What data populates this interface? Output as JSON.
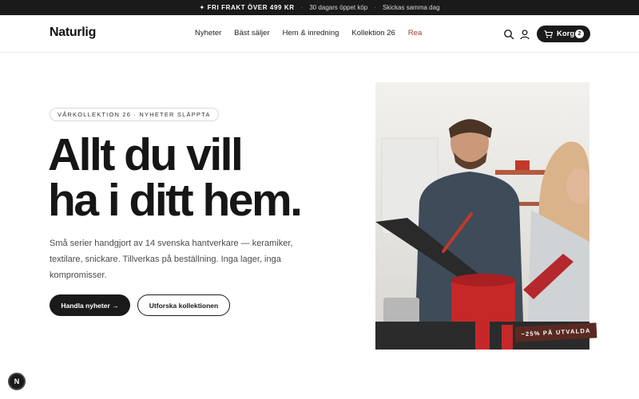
{
  "announcement": {
    "lead": "✦ FRI FRAKT ÖVER 499 KR",
    "item2": "30 dagars öppet köp",
    "item3": "Skickas samma dag",
    "separator": "·"
  },
  "header": {
    "logo": "Naturlig",
    "nav": [
      "Nyheter",
      "Bäst säljer",
      "Hem & inredning",
      "Kollektion 26",
      "Rea"
    ],
    "cart_label": "Korg",
    "cart_count": "2"
  },
  "hero": {
    "pill": "VÅRKOLLEKTION 26 · NYHETER SLÄPPTA",
    "headline_line1": "Allt du vill",
    "headline_line2": "ha i ditt hem.",
    "lede": "Små serier handgjort av 14 svenska hantverkare — keramiker, textilare, snickare. Tillverkas på beställning. Inga lager, inga kompromisser.",
    "cta_primary": "Handla nyheter →",
    "cta_secondary": "Utforska kollektionen",
    "badge": "−25% PÅ UTVALDA"
  },
  "fab_label": "N",
  "colors": {
    "dark": "#1a1a1a",
    "sale": "#9b3b2f",
    "badge": "#5a2a22"
  }
}
